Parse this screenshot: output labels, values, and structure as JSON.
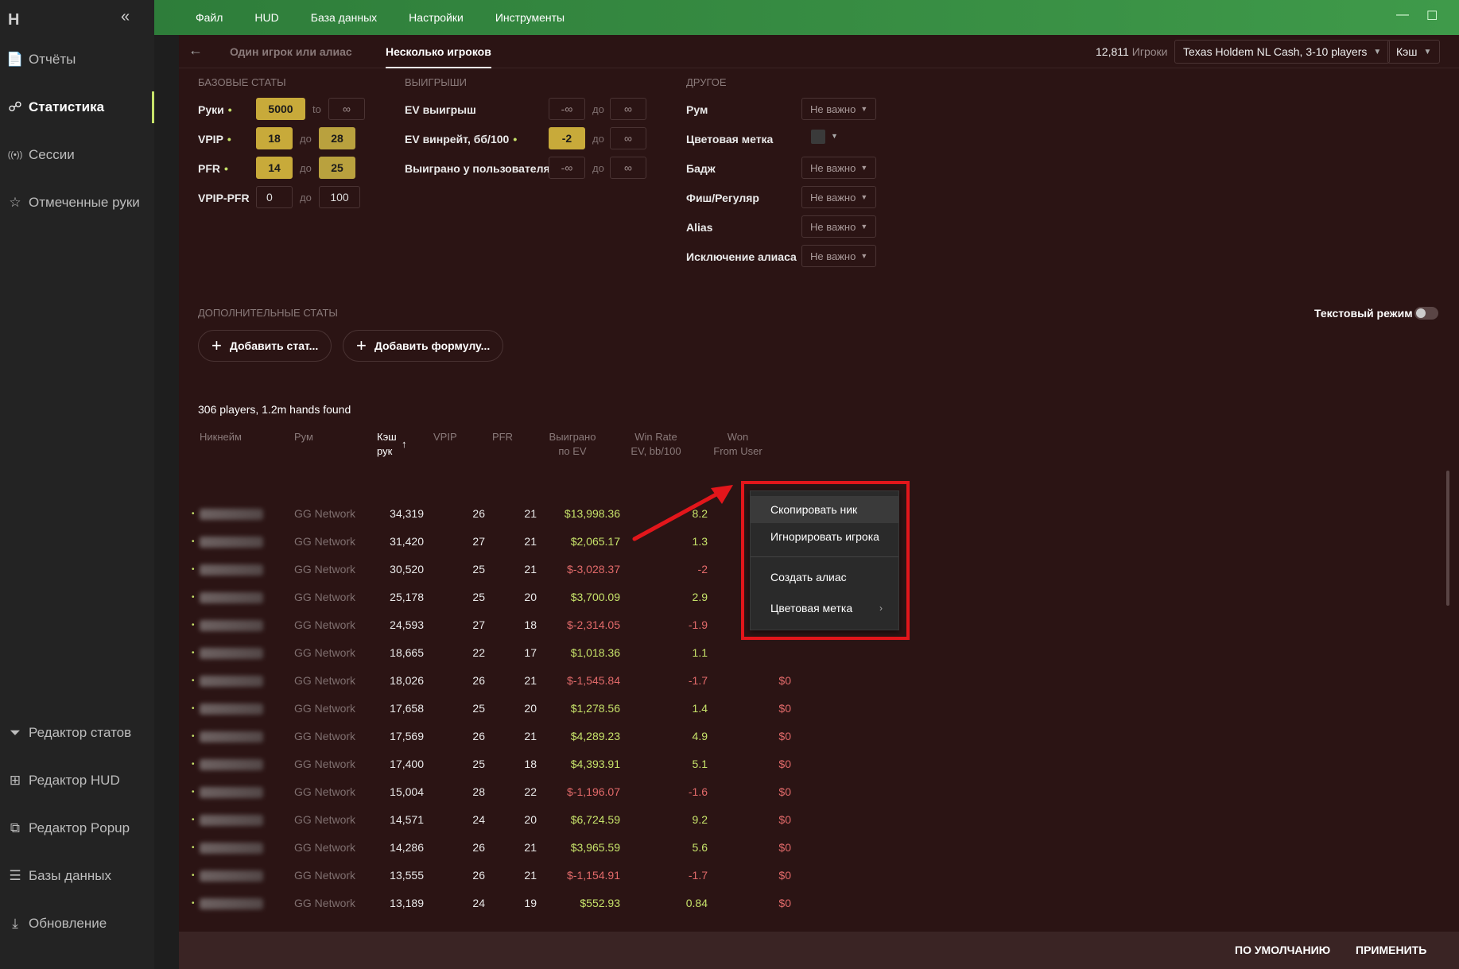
{
  "sidebar": {
    "logo": "H",
    "collapse": "«",
    "items": [
      {
        "label": "Отчёты",
        "icon": "📄"
      },
      {
        "label": "Статистика",
        "icon": "☍"
      },
      {
        "label": "Сессии",
        "icon": "((•))"
      },
      {
        "label": "Отмеченные руки",
        "icon": "☆"
      }
    ],
    "bottom_items": [
      {
        "label": "Редактор статов",
        "icon": "⏷"
      },
      {
        "label": "Редактор HUD",
        "icon": "⊞"
      },
      {
        "label": "Редактор Popup",
        "icon": "⧉"
      },
      {
        "label": "Базы данных",
        "icon": "☰"
      },
      {
        "label": "Обновление",
        "icon": "⤓"
      }
    ]
  },
  "topbar": {
    "menu": [
      "Файл",
      "HUD",
      "База данных",
      "Настройки",
      "Инструменты"
    ],
    "minimize": "—",
    "maximize": "☐"
  },
  "tabs": {
    "back": "←",
    "items": [
      "Один игрок или алиас",
      "Несколько игроков"
    ],
    "active": "Несколько игроков",
    "player_count": "12,811",
    "player_count_label": "Игроки",
    "game_filter": "Texas Holdem NL Cash, 3-10 players",
    "mode_filter": "Кэш"
  },
  "filters": {
    "basic_title": "БАЗОВЫЕ СТАТЫ",
    "basic": [
      {
        "label": "Руки",
        "from": "5000",
        "sep": "to",
        "to": "∞"
      },
      {
        "label": "VPIP",
        "from": "18",
        "sep": "до",
        "to": "28"
      },
      {
        "label": "PFR",
        "from": "14",
        "sep": "до",
        "to": "25"
      },
      {
        "label": "VPIP-PFR",
        "from": "0",
        "sep": "до",
        "to": "100"
      }
    ],
    "winnings_title": "ВЫИГРЫШИ",
    "winnings": [
      {
        "label": "EV выигрыш",
        "from": "-∞",
        "sep": "до",
        "to": "∞"
      },
      {
        "label": "EV винрейт, бб/100",
        "from": "-2",
        "sep": "до",
        "to": "∞"
      },
      {
        "label": "Выиграно у пользователя",
        "from": "-∞",
        "sep": "до",
        "to": "∞"
      }
    ],
    "other_title": "ДРУГОЕ",
    "other": [
      {
        "label": "Рум",
        "value": "Не важно"
      },
      {
        "label": "Цветовая метка",
        "value": ""
      },
      {
        "label": "Бадж",
        "value": "Не важно"
      },
      {
        "label": "Фиш/Регуляр",
        "value": "Не важно"
      },
      {
        "label": "Alias",
        "value": "Не важно"
      },
      {
        "label": "Исключение алиаса",
        "value": "Не важно"
      }
    ],
    "dot": "•"
  },
  "extra": {
    "title": "ДОПОЛНИТЕЛЬНЫЕ СТАТЫ",
    "add_stat": "Добавить стат...",
    "add_formula": "Добавить формулу...",
    "text_mode": "Текстовый режим"
  },
  "results": {
    "found": "306 players, 1.2m hands found",
    "headers": {
      "nick": "Никнейм",
      "room": "Рум",
      "hands_1": "Кэш",
      "hands_2": "рук",
      "sort": "↑",
      "vpip": "VPIP",
      "pfr": "PFR",
      "ev_1": "Выиграно",
      "ev_2": "по EV",
      "wr_1": "Win Rate",
      "wr_2": "EV, bb/100",
      "won_1": "Won",
      "won_2": "From User"
    },
    "rows": [
      {
        "room": "GG Network",
        "hands": "34,319",
        "vpip": "26",
        "pfr": "21",
        "ev": "$13,998.36",
        "wr": "8.2",
        "won": ""
      },
      {
        "room": "GG Network",
        "hands": "31,420",
        "vpip": "27",
        "pfr": "21",
        "ev": "$2,065.17",
        "wr": "1.3",
        "won": ""
      },
      {
        "room": "GG Network",
        "hands": "30,520",
        "vpip": "25",
        "pfr": "21",
        "ev": "$-3,028.37",
        "wr": "-2",
        "won": ""
      },
      {
        "room": "GG Network",
        "hands": "25,178",
        "vpip": "25",
        "pfr": "20",
        "ev": "$3,700.09",
        "wr": "2.9",
        "won": ""
      },
      {
        "room": "GG Network",
        "hands": "24,593",
        "vpip": "27",
        "pfr": "18",
        "ev": "$-2,314.05",
        "wr": "-1.9",
        "won": ""
      },
      {
        "room": "GG Network",
        "hands": "18,665",
        "vpip": "22",
        "pfr": "17",
        "ev": "$1,018.36",
        "wr": "1.1",
        "won": ""
      },
      {
        "room": "GG Network",
        "hands": "18,026",
        "vpip": "26",
        "pfr": "21",
        "ev": "$-1,545.84",
        "wr": "-1.7",
        "won": "$0"
      },
      {
        "room": "GG Network",
        "hands": "17,658",
        "vpip": "25",
        "pfr": "20",
        "ev": "$1,278.56",
        "wr": "1.4",
        "won": "$0"
      },
      {
        "room": "GG Network",
        "hands": "17,569",
        "vpip": "26",
        "pfr": "21",
        "ev": "$4,289.23",
        "wr": "4.9",
        "won": "$0"
      },
      {
        "room": "GG Network",
        "hands": "17,400",
        "vpip": "25",
        "pfr": "18",
        "ev": "$4,393.91",
        "wr": "5.1",
        "won": "$0"
      },
      {
        "room": "GG Network",
        "hands": "15,004",
        "vpip": "28",
        "pfr": "22",
        "ev": "$-1,196.07",
        "wr": "-1.6",
        "won": "$0"
      },
      {
        "room": "GG Network",
        "hands": "14,571",
        "vpip": "24",
        "pfr": "20",
        "ev": "$6,724.59",
        "wr": "9.2",
        "won": "$0"
      },
      {
        "room": "GG Network",
        "hands": "14,286",
        "vpip": "26",
        "pfr": "21",
        "ev": "$3,965.59",
        "wr": "5.6",
        "won": "$0"
      },
      {
        "room": "GG Network",
        "hands": "13,555",
        "vpip": "26",
        "pfr": "21",
        "ev": "$-1,154.91",
        "wr": "-1.7",
        "won": "$0"
      },
      {
        "room": "GG Network",
        "hands": "13,189",
        "vpip": "24",
        "pfr": "19",
        "ev": "$552.93",
        "wr": "0.84",
        "won": "$0"
      }
    ]
  },
  "context_menu": {
    "items": [
      "Скопировать ник",
      "Игнорировать игрока",
      "Создать алиас",
      "Цветовая метка"
    ],
    "submenu_arrow": "›",
    "highlight_color": "#e3161b"
  },
  "bottombar": {
    "default_label": "ПО УМОЛЧАНИЮ",
    "apply_label": "ПРИМЕНИТЬ"
  },
  "colors": {
    "accent": "#c6e26a",
    "positive": "#c6e26a",
    "negative": "#e26a6a",
    "panel_bg": "#2b1414",
    "topbar": "#3f9a4a"
  }
}
